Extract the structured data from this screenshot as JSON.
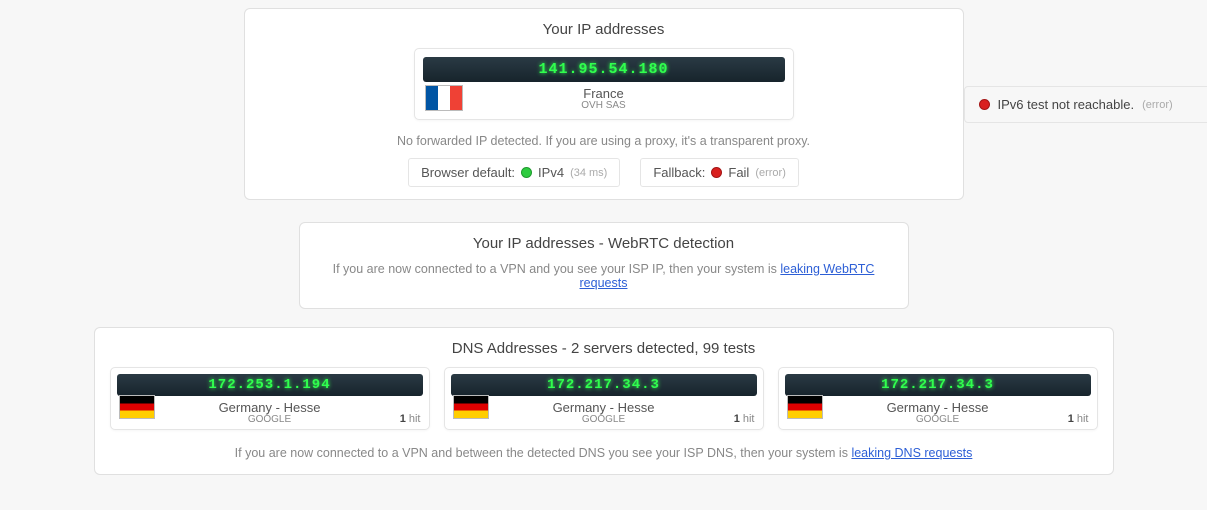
{
  "ip_section": {
    "title": "Your IP addresses",
    "main": {
      "ip": "141.95.54.180",
      "country": "France",
      "isp": "OVH SAS",
      "flag": "fr"
    },
    "forwarded_note": "No forwarded IP detected. If you are using a proxy, it's a transparent proxy.",
    "ipv6": {
      "text": "IPv6 test not reachable.",
      "suffix": "(error)"
    },
    "browser_default": {
      "label": "Browser default:",
      "proto": "IPv4",
      "latency": "(34 ms)"
    },
    "fallback": {
      "label": "Fallback:",
      "status": "Fail",
      "suffix": "(error)"
    }
  },
  "webrtc_section": {
    "title": "Your IP addresses - WebRTC detection",
    "note_prefix": "If you are now connected to a VPN and you see your ISP IP, then your system is ",
    "link_text": "leaking WebRTC requests"
  },
  "dns_section": {
    "title": "DNS Addresses - 2 servers detected, 99 tests",
    "servers": [
      {
        "ip": "172.253.1.194",
        "location": "Germany - Hesse",
        "provider": "GOOGLE",
        "hits_num": "1",
        "hits_label": "hit",
        "flag": "de"
      },
      {
        "ip": "172.217.34.3",
        "location": "Germany - Hesse",
        "provider": "GOOGLE",
        "hits_num": "1",
        "hits_label": "hit",
        "flag": "de"
      },
      {
        "ip": "172.217.34.3",
        "location": "Germany - Hesse",
        "provider": "GOOGLE",
        "hits_num": "1",
        "hits_label": "hit",
        "flag": "de"
      }
    ],
    "note_prefix": "If you are now connected to a VPN and between the detected DNS you see your ISP DNS, then your system is ",
    "link_text": "leaking DNS requests"
  }
}
